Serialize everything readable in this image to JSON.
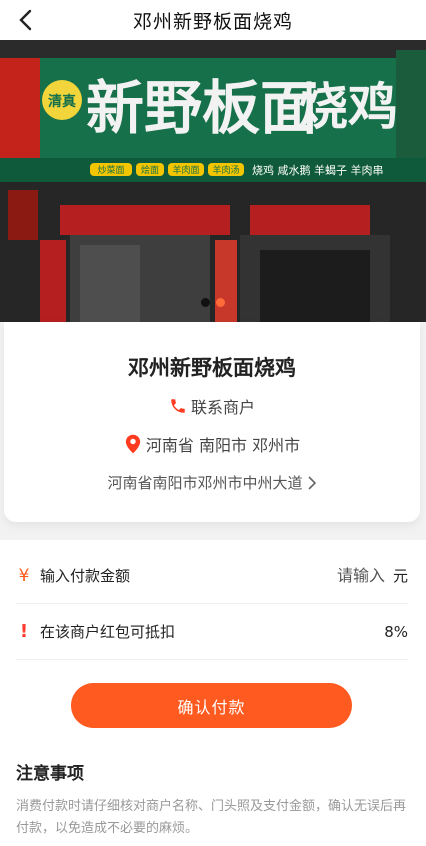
{
  "header": {
    "title": "邓州新野板面烧鸡",
    "back_icon": "chevron-left-icon"
  },
  "banner": {
    "sign_main": "新野板面",
    "sign_side": "烧鸡",
    "sign_badge": "清真",
    "sign_sub_left": [
      "炒菜面",
      "烩面",
      "羊肉面",
      "羊肉汤"
    ],
    "sign_sub_right": "烧鸡  咸水鹅  羊蝎子  羊肉串",
    "slides": 2,
    "active_slide": 1
  },
  "shop": {
    "name": "邓州新野板面烧鸡",
    "contact_label": "联系商户",
    "region": "河南省 南阳市 邓州市",
    "address": "河南省南阳市邓州市中州大道",
    "contact_icon": "phone-icon",
    "location_icon": "location-pin-icon"
  },
  "payment": {
    "amount_label": "输入付款金额",
    "amount_placeholder": "请输入",
    "currency_unit": "元",
    "redpacket_label": "在该商户红包可抵扣",
    "redpacket_value": "8%",
    "confirm_label": "确认付款",
    "yuan_symbol": "¥",
    "warn_symbol": "!"
  },
  "notice": {
    "title": "注意事项",
    "text": "消费付款时请仔细核对商户名称、门头照及支付金额，确认无误后再付款，以免造成不必要的麻烦。"
  },
  "colors": {
    "accent": "#ff5a1f",
    "warn": "#ff3b2f"
  }
}
